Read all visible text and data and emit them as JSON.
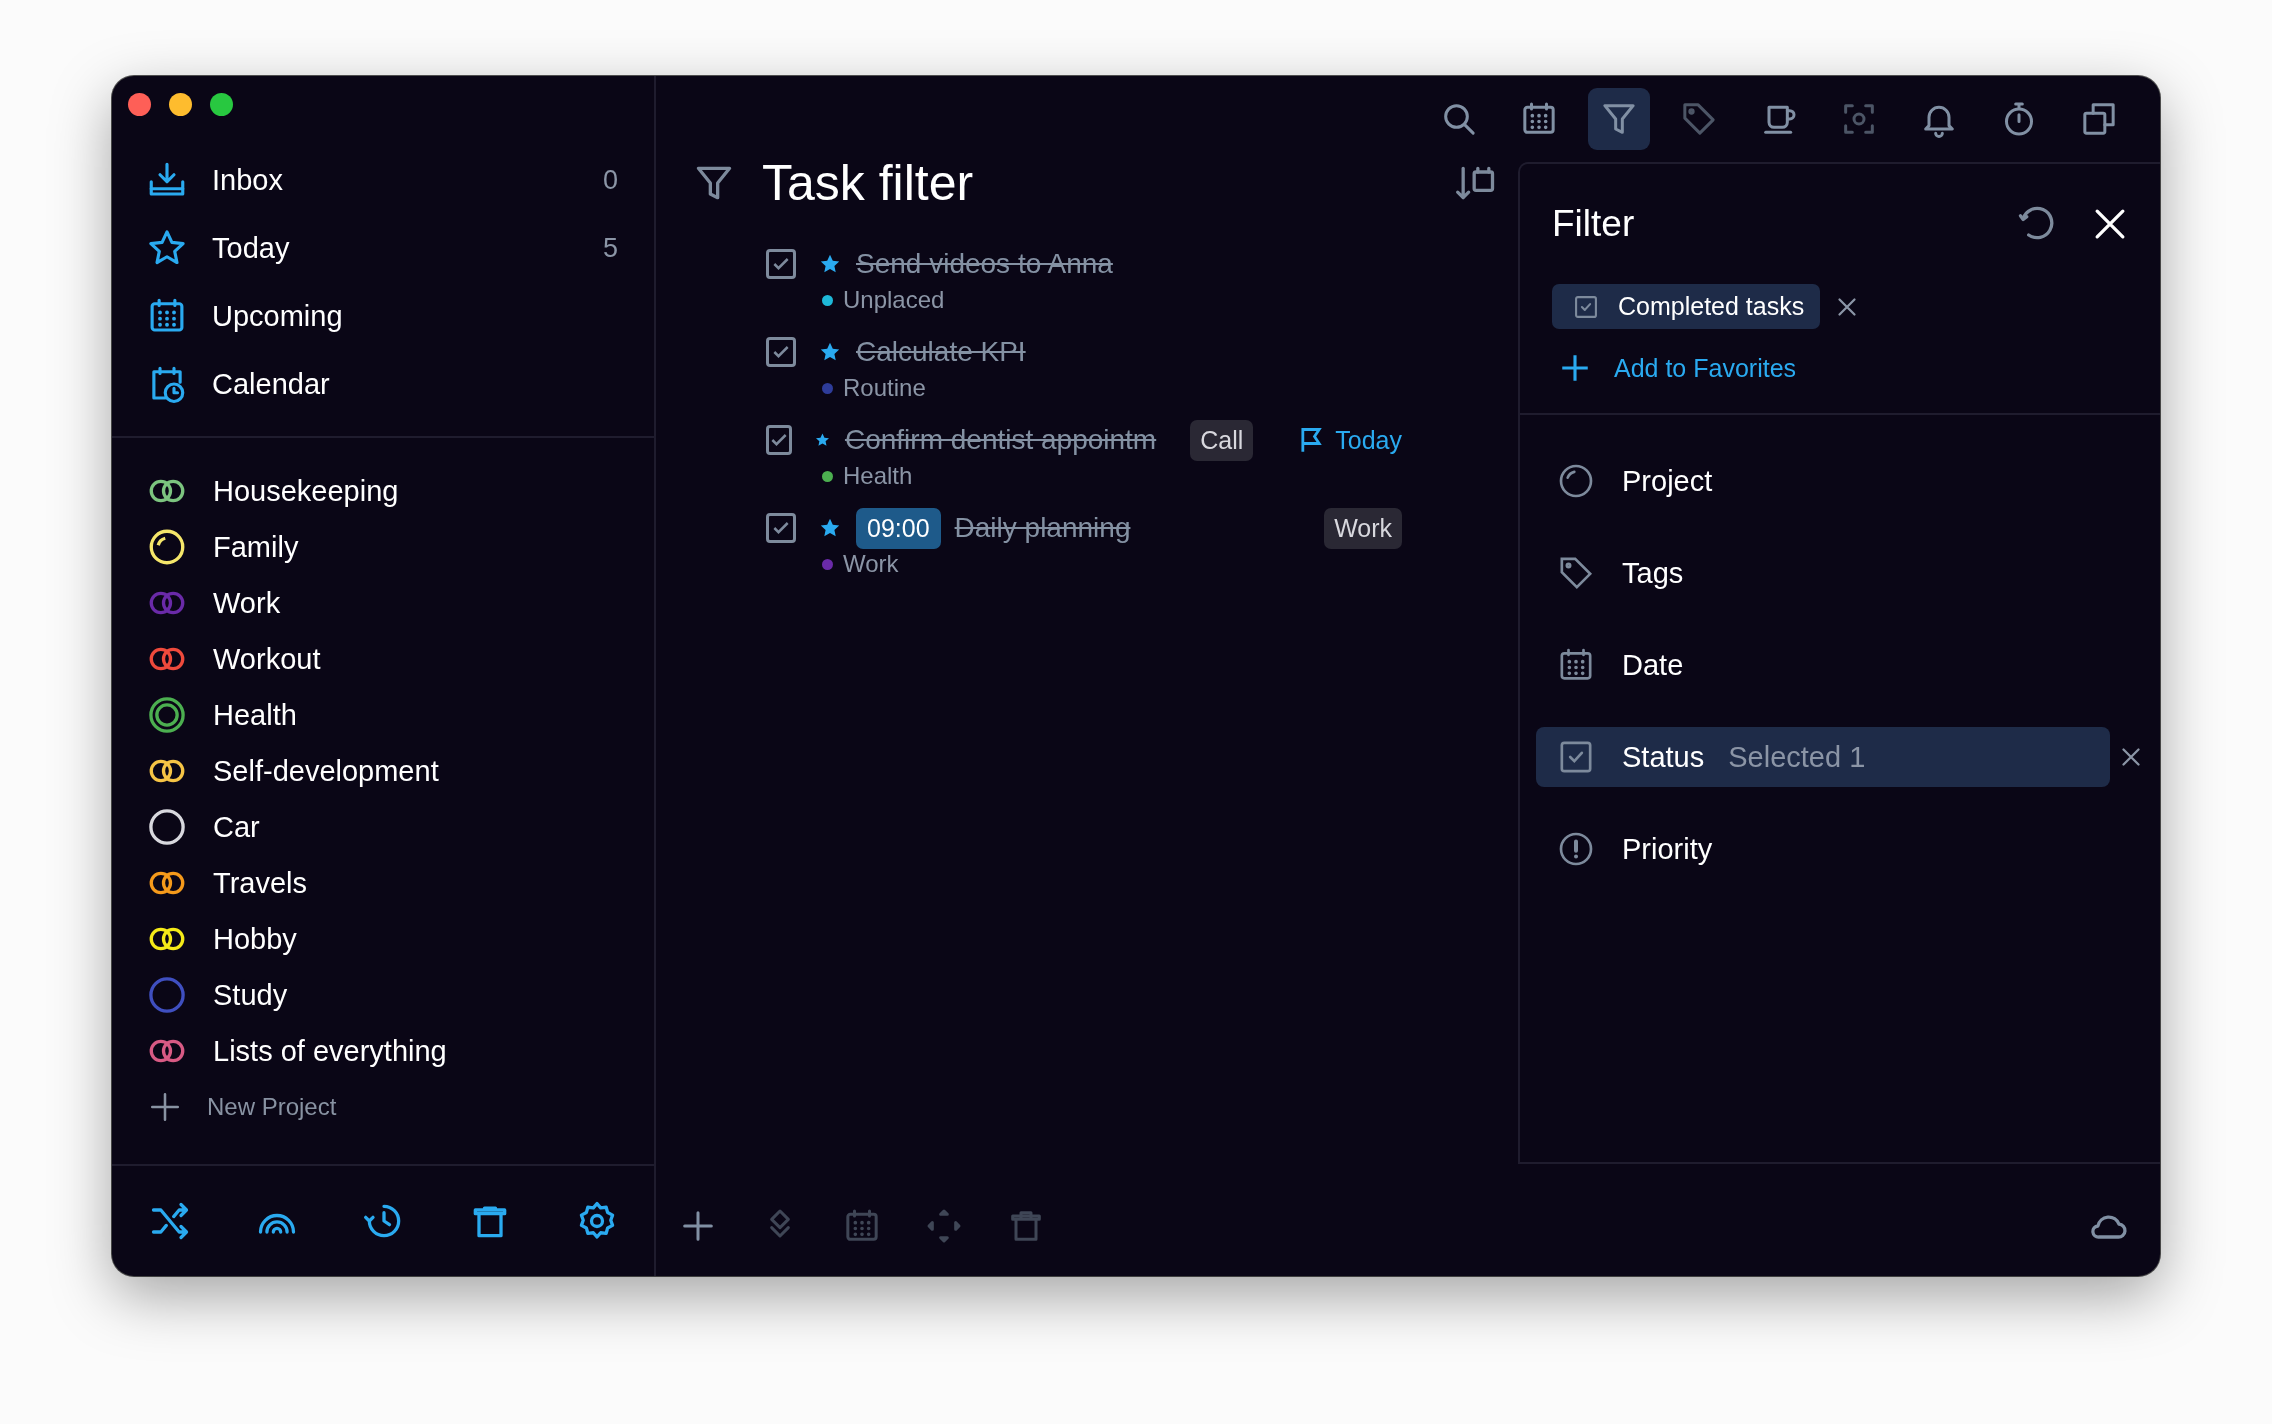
{
  "sidebar": {
    "nav": [
      {
        "label": "Inbox",
        "count": "0"
      },
      {
        "label": "Today",
        "count": "5"
      },
      {
        "label": "Upcoming"
      },
      {
        "label": "Calendar"
      }
    ],
    "projects": [
      {
        "name": "Housekeeping",
        "color": "#7cc47f",
        "kind": "pair"
      },
      {
        "name": "Family",
        "color": "#f5e66a",
        "kind": "partial"
      },
      {
        "name": "Work",
        "color": "#6a2aa8",
        "kind": "pair"
      },
      {
        "name": "Workout",
        "color": "#ef4a3c",
        "kind": "pair"
      },
      {
        "name": "Health",
        "color": "#4caf50",
        "kind": "double"
      },
      {
        "name": "Self-development",
        "color": "#f6c445",
        "kind": "pair"
      },
      {
        "name": "Car",
        "color": "#d8d8de",
        "kind": "single"
      },
      {
        "name": "Travels",
        "color": "#f59a1b",
        "kind": "pair"
      },
      {
        "name": "Hobby",
        "color": "#f5ea18",
        "kind": "pair"
      },
      {
        "name": "Study",
        "color": "#3f4fc0",
        "kind": "single"
      },
      {
        "name": "Lists of everything",
        "color": "#d85a84",
        "kind": "pair"
      }
    ],
    "new_project": "New Project"
  },
  "toolbar": [
    {
      "selected": false,
      "disabled": false
    },
    {
      "selected": false,
      "disabled": false
    },
    {
      "selected": true,
      "disabled": false
    },
    {
      "selected": false,
      "disabled": true
    },
    {
      "selected": false,
      "disabled": false
    },
    {
      "selected": false,
      "disabled": true
    },
    {
      "selected": false,
      "disabled": false
    },
    {
      "selected": false,
      "disabled": false
    },
    {
      "selected": false,
      "disabled": false
    }
  ],
  "main": {
    "title": "Task filter",
    "tasks": [
      {
        "title": "Send videos to Anna",
        "checked": true,
        "starred": true,
        "project": {
          "name": "Unplaced",
          "color": "#1eb8d8"
        }
      },
      {
        "title": "Calculate KPI",
        "checked": true,
        "starred": true,
        "project": {
          "name": "Routine",
          "color": "#2e3c9a"
        }
      },
      {
        "title": "Confirm dentist appointm",
        "checked": true,
        "starred": true,
        "project": {
          "name": "Health",
          "color": "#4caf50"
        },
        "tags": [
          "Call"
        ],
        "due": "Today"
      },
      {
        "title": "Daily planning",
        "checked": true,
        "starred": true,
        "time": "09:00",
        "project": {
          "name": "Work",
          "color": "#6a2aa8"
        },
        "tags": [
          "Work"
        ]
      }
    ]
  },
  "filter": {
    "title": "Filter",
    "chips": [
      "Completed tasks"
    ],
    "add_favorites": "Add to Favorites",
    "criteria": [
      {
        "label": "Project",
        "selected": false
      },
      {
        "label": "Tags",
        "selected": false
      },
      {
        "label": "Date",
        "selected": false
      },
      {
        "label": "Status",
        "value": "Selected 1",
        "selected": true
      },
      {
        "label": "Priority",
        "selected": false
      }
    ]
  },
  "bottom_toolbar": [
    {
      "disabled": false
    },
    {
      "disabled": true
    },
    {
      "disabled": true
    },
    {
      "disabled": true
    },
    {
      "disabled": true
    }
  ]
}
